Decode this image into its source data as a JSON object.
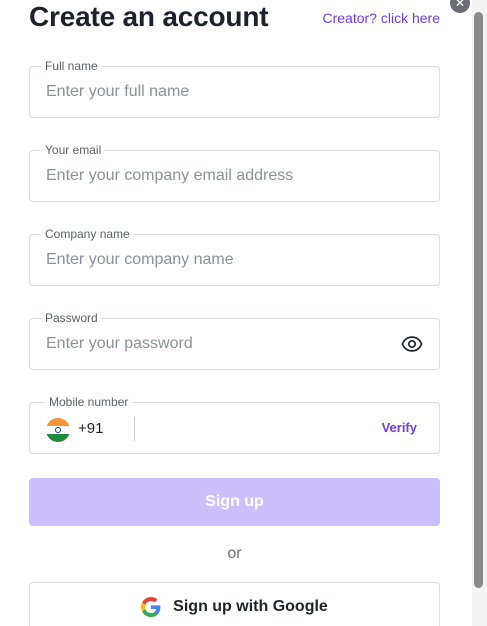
{
  "header": {
    "title": "Create an account",
    "creator_link": "Creator? click here"
  },
  "form": {
    "full_name": {
      "label": "Full name",
      "placeholder": "Enter your full name",
      "value": ""
    },
    "email": {
      "label": "Your email",
      "placeholder": "Enter your company email address",
      "value": ""
    },
    "company": {
      "label": "Company name",
      "placeholder": "Enter your company name",
      "value": ""
    },
    "password": {
      "label": "Password",
      "placeholder": "Enter your password",
      "value": ""
    },
    "mobile": {
      "label": "Mobile number",
      "country_code": "+91",
      "value": "",
      "verify_label": "Verify"
    }
  },
  "actions": {
    "signup_label": "Sign up",
    "or_label": "or",
    "google_label": "Sign up with Google"
  },
  "icons": {
    "close": "close-icon",
    "eye": "eye-icon",
    "flag": "india-flag-icon",
    "google": "google-icon"
  },
  "colors": {
    "accent": "#6c3bf0",
    "signup_disabled_bg": "#cbbffd",
    "border": "#d9dce1"
  }
}
